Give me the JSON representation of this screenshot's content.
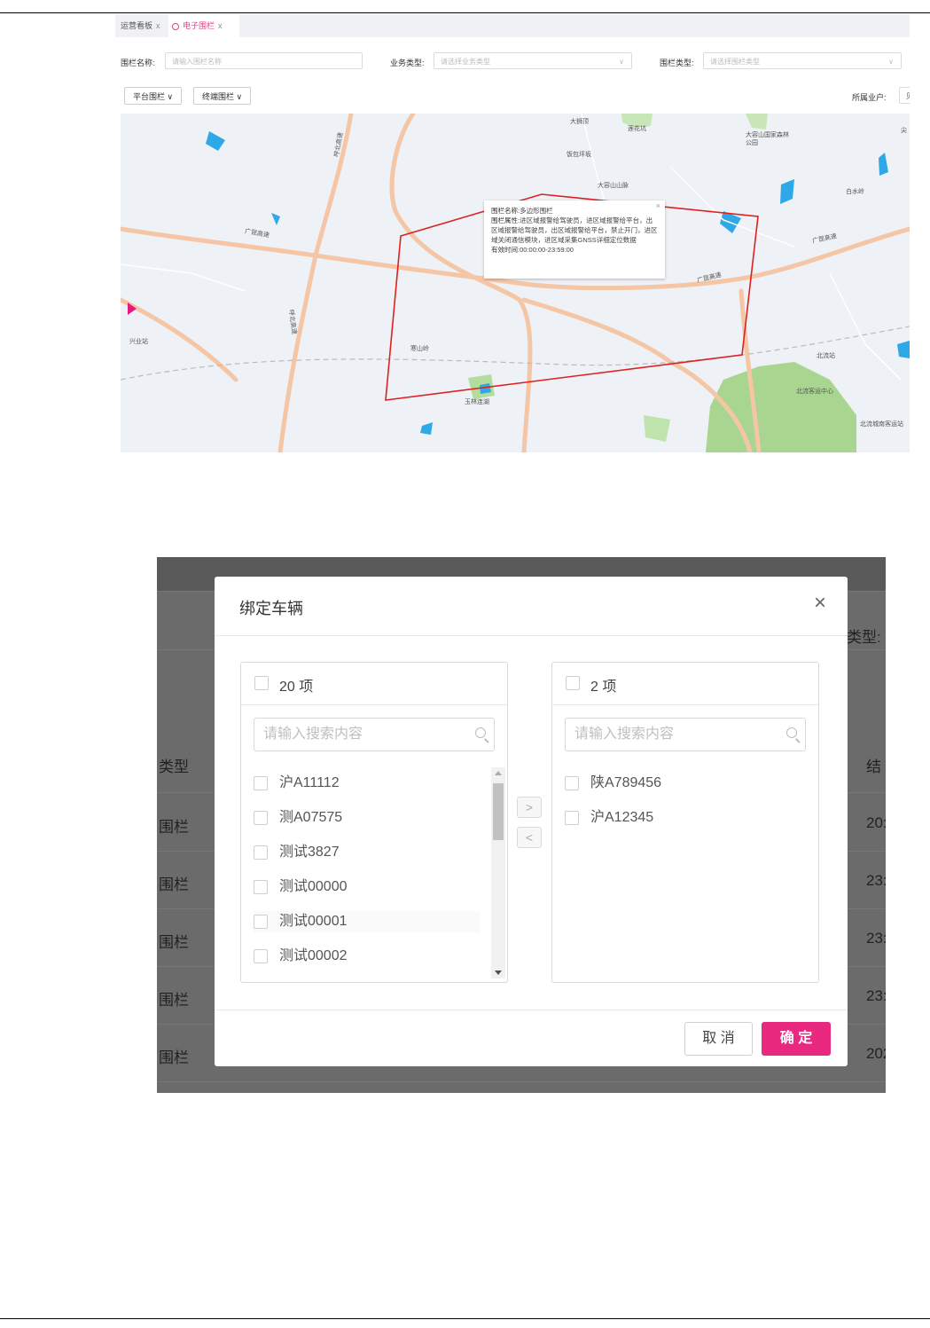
{
  "screenshot1": {
    "tabs": [
      {
        "label": "运营看板",
        "close": "x"
      },
      {
        "label": "电子围栏",
        "close": "x"
      }
    ],
    "filters": {
      "fence_name_label": "围栏名称:",
      "fence_name_placeholder": "请输入围栏名称",
      "business_type_label": "业务类型:",
      "business_type_placeholder": "请选择业务类型",
      "fence_type_label": "围栏类型:",
      "fence_type_placeholder": "请选择围栏类型",
      "platform_fence_btn": "平台围栏 ∨",
      "terminal_fence_btn": "终端围栏 ∨",
      "tenant_label": "所属业户:",
      "tenant_value_partial": "见"
    },
    "map_popup": {
      "close": "×",
      "name_label": "围栏名称:",
      "name_value": "多边形围栏",
      "attr_label": "围栏属性:",
      "attr_value": "进区域报警给驾驶员，进区域报警给平台，出区域报警给驾驶员，出区域报警给平台，禁止开门，进区域关闭通信模块，进区域采集GNSS详细定位数据",
      "valid_label": "有效时间:",
      "valid_value": "00:00:00-23:59:00"
    },
    "map_labels": [
      "大狮顶",
      "莲花坑",
      "饭包坪坂",
      "大容山国家森林公园",
      "大容山山脉",
      "白水岭",
      "广昆高速",
      "广昆高速",
      "广昆高速",
      "呼北高速",
      "呼北高速",
      "寒山岭",
      "玉林连湖",
      "兴业站",
      "北流站",
      "北流客运中心",
      "北流城南客运站",
      "尖"
    ]
  },
  "screenshot2": {
    "background": {
      "type_header_right": "类型:",
      "type_col_header": "类型",
      "end_col_header": "结",
      "rows": [
        {
          "left": "围栏",
          "right": "20:"
        },
        {
          "left": "围栏",
          "right": "23:"
        },
        {
          "left": "围栏",
          "right": "23:"
        },
        {
          "left": "围栏",
          "right": "23:"
        },
        {
          "left": "围栏",
          "right": "202"
        }
      ]
    },
    "modal": {
      "title": "绑定车辆",
      "close": "×",
      "left_panel": {
        "count": "20 项",
        "search_placeholder": "请输入搜索内容",
        "items": [
          "沪A11112",
          "测A07575",
          "测试3827",
          "测试00000",
          "测试00001",
          "测试00002"
        ]
      },
      "right_panel": {
        "count": "2 项",
        "search_placeholder": "请输入搜索内容",
        "items": [
          "陕A789456",
          "沪A12345"
        ]
      },
      "move_right": ">",
      "move_left": "<",
      "cancel_label": "取 消",
      "confirm_label": "确 定",
      "accent_color": "#e8297f"
    }
  }
}
